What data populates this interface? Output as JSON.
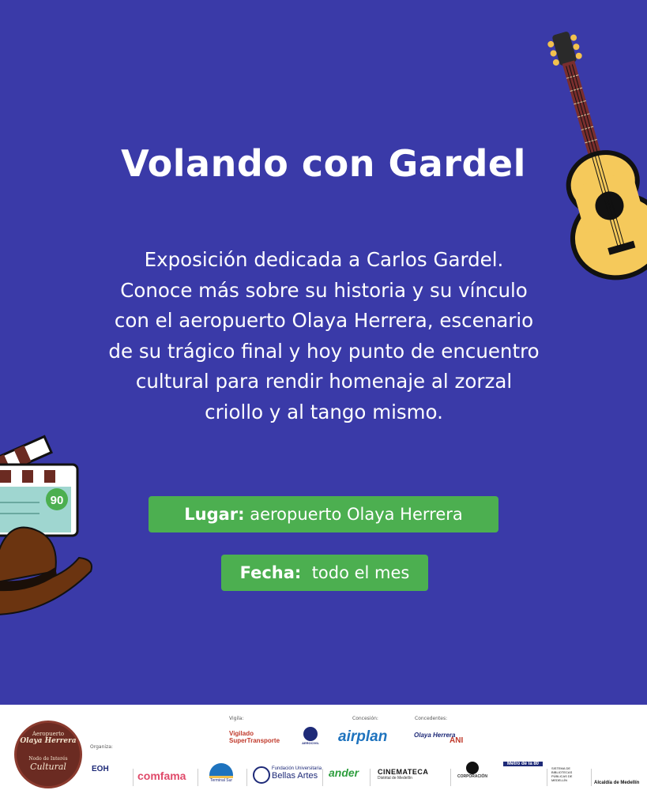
{
  "title": "Volando con Gardel",
  "description": [
    "Exposición dedicada a Carlos Gardel.",
    "Conoce más sobre su historia y su vínculo",
    "con el aeropuerto Olaya Herrera, escenario",
    "de su trágico final y hoy punto de encuentro",
    "cultural para rendir homenaje al zorzal",
    "criollo y al tango mismo."
  ],
  "lugar": {
    "label": "Lugar:",
    "value": "aeropuerto Olaya Herrera"
  },
  "fecha": {
    "label": "Fecha:",
    "value": "todo el mes"
  },
  "clapper_number": "90",
  "colors": {
    "background": "#3a3aa8",
    "pill": "#4caf50",
    "text": "#ffffff"
  },
  "footer": {
    "seal": {
      "line1": "Aeropuerto",
      "line2": "Olaya Herrera",
      "line3": "Nodo de Interés",
      "line4": "Cultural"
    },
    "labels": {
      "vigila": "Vigila:",
      "concesion": "Concesión:",
      "concedentes": "Concedentes:",
      "organiza": "Organiza:"
    },
    "logos": {
      "supertransporte": "Vigilado SuperTransporte",
      "aerocivil": "AEROCIVIL",
      "airplan": "airplan",
      "olaya": "Olaya Herrera",
      "ani": "ANI",
      "eoh": "EOH",
      "comfama": "comfama",
      "terminal": "Terminal Sur",
      "bellas_artes": "Bellas Artes",
      "bellas_artes_pre": "Fundación Universitaria",
      "ander": "ander",
      "cinemateca": "CINEMATECA",
      "cinemateca_sub": "Distrital de Medellín",
      "corporacion": "CORPORACIÓN",
      "metro": "Metro de la 80",
      "bibliotecas": "SISTEMA DE BIBLIOTECAS PÚBLICAS DE MEDELLÍN",
      "alcaldia": "Alcaldía de Medellín"
    }
  }
}
